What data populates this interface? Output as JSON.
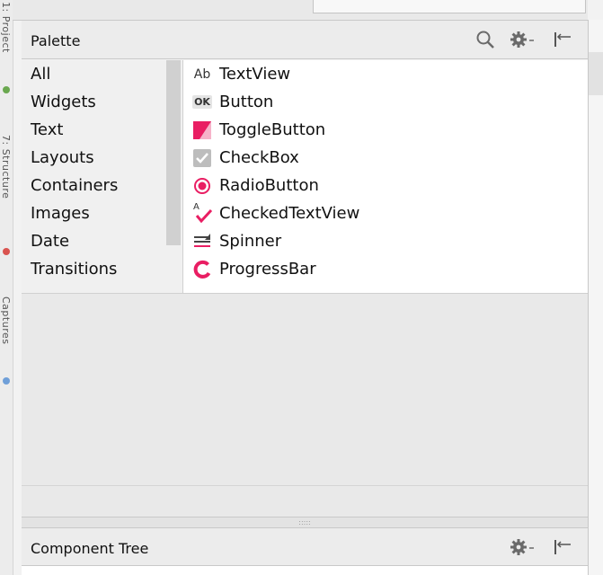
{
  "left_strip": {
    "tools": [
      "1: Project",
      "7: Structure",
      "Captures"
    ]
  },
  "palette": {
    "title": "Palette",
    "categories": [
      {
        "label": "All"
      },
      {
        "label": "Widgets"
      },
      {
        "label": "Text"
      },
      {
        "label": "Layouts"
      },
      {
        "label": "Containers"
      },
      {
        "label": "Images"
      },
      {
        "label": "Date"
      },
      {
        "label": "Transitions"
      }
    ],
    "widgets": [
      {
        "label": "TextView",
        "icon": "ab-text-icon",
        "icon_text": "Ab"
      },
      {
        "label": "Button",
        "icon": "ok-button-icon",
        "icon_text": "OK"
      },
      {
        "label": "ToggleButton",
        "icon": "toggle-icon",
        "icon_text": ""
      },
      {
        "label": "CheckBox",
        "icon": "checkbox-icon",
        "icon_text": ""
      },
      {
        "label": "RadioButton",
        "icon": "radio-icon",
        "icon_text": ""
      },
      {
        "label": "CheckedTextView",
        "icon": "checked-text-icon",
        "icon_text": "A"
      },
      {
        "label": "Spinner",
        "icon": "spinner-icon",
        "icon_text": ""
      },
      {
        "label": "ProgressBar",
        "icon": "progress-icon",
        "icon_text": ""
      }
    ]
  },
  "component_tree": {
    "title": "Component Tree"
  },
  "colors": {
    "accent": "#e91e63",
    "checkbox_grey": "#bdbdbd"
  }
}
